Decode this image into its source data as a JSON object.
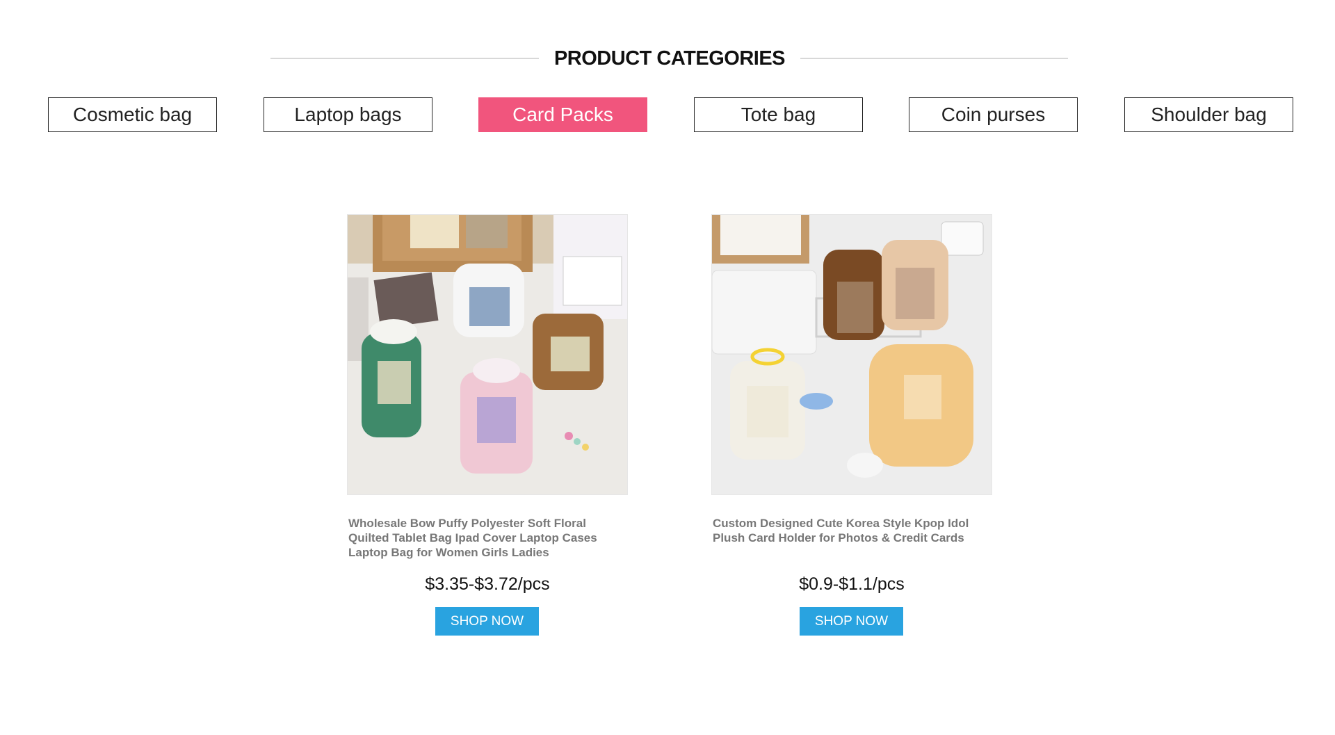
{
  "section": {
    "title": "PRODUCT CATEGORIES"
  },
  "tabs": [
    {
      "label": "Cosmetic bag",
      "active": false
    },
    {
      "label": "Laptop bags",
      "active": false
    },
    {
      "label": "Card Packs",
      "active": true
    },
    {
      "label": "Tote bag",
      "active": false
    },
    {
      "label": "Coin purses",
      "active": false
    },
    {
      "label": "Shoulder bag",
      "active": false
    }
  ],
  "products": [
    {
      "title": "Wholesale Bow Puffy Polyester Soft Floral Quilted Tablet Bag Ipad Cover Laptop Cases Laptop Bag for Women Girls Ladies",
      "price": "$3.35-$3.72/pcs",
      "button": "SHOP NOW"
    },
    {
      "title": "Custom Designed Cute Korea Style Kpop Idol Plush Card Holder for Photos & Credit Cards",
      "price": "$0.9-$1.1/pcs",
      "button": "SHOP NOW"
    }
  ],
  "colors": {
    "active_tab": "#f1557d",
    "button": "#29a3e0"
  }
}
